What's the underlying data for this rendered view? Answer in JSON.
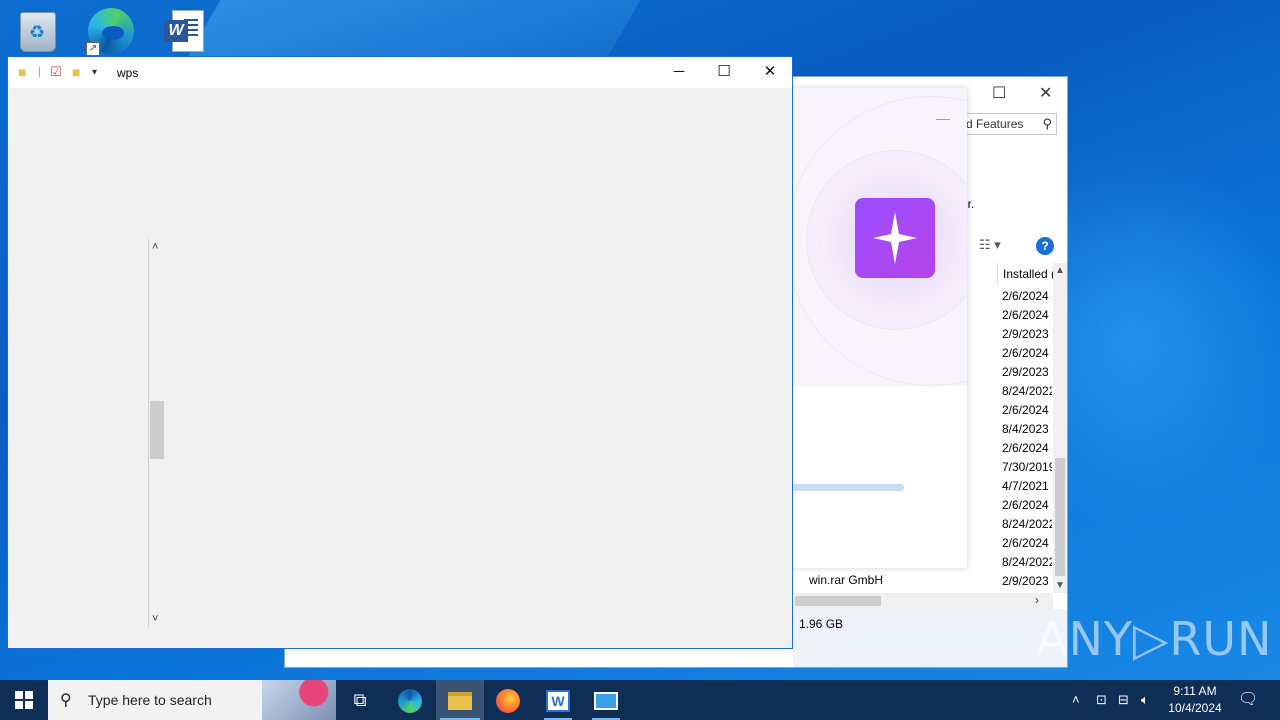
{
  "desktop": {
    "icons": [
      {
        "name": "recycle-bin"
      },
      {
        "name": "microsoft-edge"
      },
      {
        "name": "word-document"
      }
    ]
  },
  "background_window": {
    "search_placeholder": "d Features",
    "repair_fragment": "ir.",
    "column_header": "Installed (",
    "installed_dates": [
      "2/6/2024",
      "2/6/2024",
      "2/9/2023",
      "2/6/2024",
      "2/9/2023",
      "8/24/2022",
      "2/6/2024",
      "8/4/2023",
      "2/6/2024",
      "7/30/2019",
      "4/7/2021",
      "2/6/2024",
      "8/24/2022",
      "2/6/2024",
      "8/24/2022",
      "2/9/2023"
    ],
    "last_publisher": "win.rar GmbH",
    "total_size": "1.96 GB"
  },
  "popup": {
    "minimize_label": "—",
    "progress_fraction": 1.0,
    "accent": "#9b4dff"
  },
  "front_window": {
    "title": "wps",
    "minimize_glyph": "─",
    "maximize_glyph": "☐",
    "close_glyph": "✕",
    "scroll_up": "˄",
    "scroll_down": "˅"
  },
  "watermark": "ANY▷RUN",
  "taskbar": {
    "search_placeholder": "Type here to search",
    "time": "9:11 AM",
    "date": "10/4/2024"
  }
}
